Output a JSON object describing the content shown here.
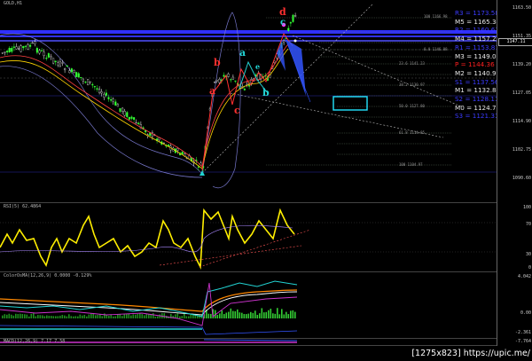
{
  "chart": {
    "symbol_label": "GOLD,H1",
    "rsi_label": "RSI(5) 62.4864",
    "macd_label": "ColorOsMA(12,26,9) 0.0000 -0.129%",
    "osc_label": "MACD(12,26,9) 7.17 7.58"
  },
  "price_axis": {
    "ticks": [
      "1163.50",
      "1151.35",
      "1139.20",
      "1127.05",
      "1114.90",
      "1102.75",
      "1090.60"
    ],
    "current_price": "1147.11",
    "rsi_ticks": [
      "100",
      "70",
      "30",
      "0"
    ],
    "macd_ticks": [
      "4.042",
      "0.00",
      "-2.361",
      "-7.764"
    ]
  },
  "levels": [
    {
      "name": "R3",
      "op": "=",
      "value": "1173.58",
      "color": "#3b3bff"
    },
    {
      "name": "M5",
      "op": "=",
      "value": "1165.34",
      "color": "#e8e8e8"
    },
    {
      "name": "R2",
      "op": "=",
      "value": "1160.61",
      "color": "#3b3bff"
    },
    {
      "name": "M4",
      "op": "=",
      "value": "1157.21",
      "color": "#e8e8e8"
    },
    {
      "name": "R1",
      "op": "=",
      "value": "1153.81",
      "color": "#3b3bff"
    },
    {
      "name": "M3",
      "op": "=",
      "value": "1149.09",
      "color": "#e8e8e8"
    },
    {
      "name": "P",
      "op": "=",
      "value": "1144.36",
      "color": "#ff2020"
    },
    {
      "name": "M2",
      "op": "=",
      "value": "1140.96",
      "color": "#e8e8e8"
    },
    {
      "name": "S1",
      "op": "=",
      "value": "1137.56",
      "color": "#3b3bff"
    },
    {
      "name": "M1",
      "op": "=",
      "value": "1132.84",
      "color": "#e8e8e8"
    },
    {
      "name": "S2",
      "op": "=",
      "value": "1128.11",
      "color": "#3b3bff"
    },
    {
      "name": "M0",
      "op": "=",
      "value": "1124.71",
      "color": "#e8e8e8"
    },
    {
      "name": "S3",
      "op": "=",
      "value": "1121.31",
      "color": "#3b3bff"
    }
  ],
  "waves": [
    {
      "text": "d",
      "color": "#ff3030"
    },
    {
      "text": "c",
      "color": "#22d3d3"
    },
    {
      "text": "b",
      "color": "#ff3030"
    },
    {
      "text": "a",
      "color": "#ff3030"
    },
    {
      "text": "a",
      "color": "#22d3d3"
    },
    {
      "text": "b",
      "color": "#22d3d3"
    },
    {
      "text": "c",
      "color": "#ff3030"
    },
    {
      "text": "e",
      "color": "#22d3d3"
    }
  ],
  "credit": "[1275x823] https://upic.me/"
}
